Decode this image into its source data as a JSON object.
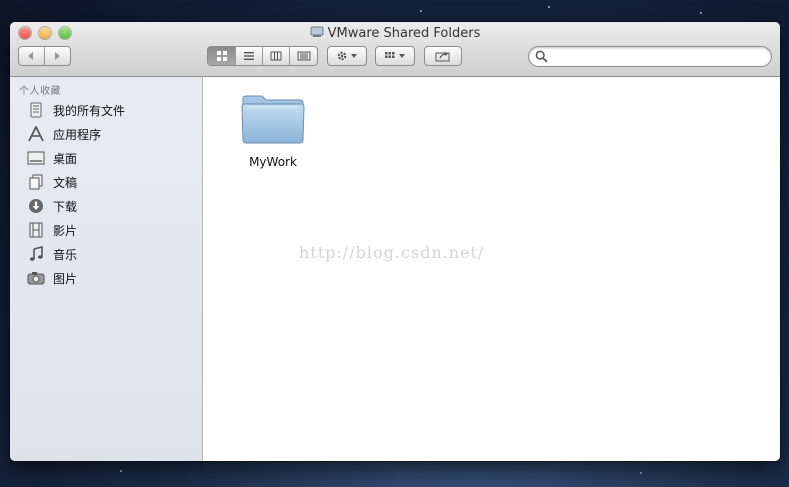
{
  "window": {
    "title": "VMware Shared Folders"
  },
  "toolbar": {
    "back_icon": "back-arrow-icon",
    "forward_icon": "forward-arrow-icon",
    "view_modes": [
      "icon-view-icon",
      "list-view-icon",
      "column-view-icon",
      "cover-flow-icon"
    ],
    "active_view": "icon-view-icon",
    "action_icon": "gear-icon",
    "arrange_icon": "arrange-grid-icon",
    "share_icon": "share-icon",
    "search_placeholder": ""
  },
  "sidebar": {
    "header": "个人收藏",
    "items": [
      {
        "label": "我的所有文件",
        "icon": "all-files-icon"
      },
      {
        "label": "应用程序",
        "icon": "applications-icon"
      },
      {
        "label": "桌面",
        "icon": "desktop-icon"
      },
      {
        "label": "文稿",
        "icon": "documents-icon"
      },
      {
        "label": "下载",
        "icon": "downloads-icon"
      },
      {
        "label": "影片",
        "icon": "movies-icon"
      },
      {
        "label": "音乐",
        "icon": "music-icon"
      },
      {
        "label": "图片",
        "icon": "pictures-icon"
      }
    ]
  },
  "content": {
    "items": [
      {
        "name": "MyWork",
        "icon": "folder-icon"
      }
    ],
    "watermark": "http://blog.csdn.net/"
  },
  "colors": {
    "sidebar_bg": "#e2e7ed",
    "folder_blue": "#8ab4d8"
  }
}
